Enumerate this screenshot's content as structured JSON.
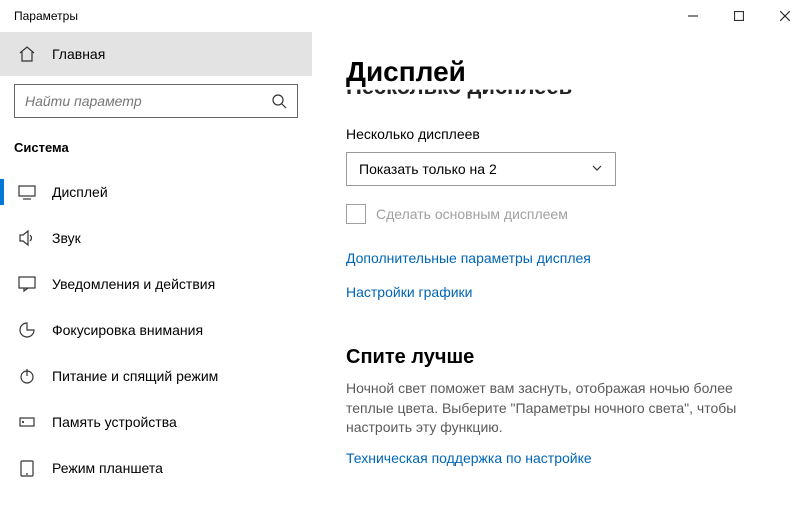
{
  "window": {
    "title": "Параметры"
  },
  "sidebar": {
    "home": "Главная",
    "search_placeholder": "Найти параметр",
    "section": "Система",
    "items": [
      {
        "label": "Дисплей"
      },
      {
        "label": "Звук"
      },
      {
        "label": "Уведомления и действия"
      },
      {
        "label": "Фокусировка внимания"
      },
      {
        "label": "Питание и спящий режим"
      },
      {
        "label": "Память устройства"
      },
      {
        "label": "Режим планшета"
      }
    ]
  },
  "content": {
    "title": "Дисплей",
    "truncated_heading": "Несколько дисплеев",
    "multi_displays_label": "Несколько дисплеев",
    "dropdown_value": "Показать только на 2",
    "checkbox_label": "Сделать основным дисплеем",
    "link_advanced": "Дополнительные параметры дисплея",
    "link_graphics": "Настройки графики",
    "sleep_heading": "Спите лучше",
    "sleep_text": "Ночной свет поможет вам заснуть, отображая ночью более теплые цвета. Выберите \"Параметры ночного света\", чтобы настроить эту функцию.",
    "link_support": "Техническая поддержка по настройке"
  }
}
